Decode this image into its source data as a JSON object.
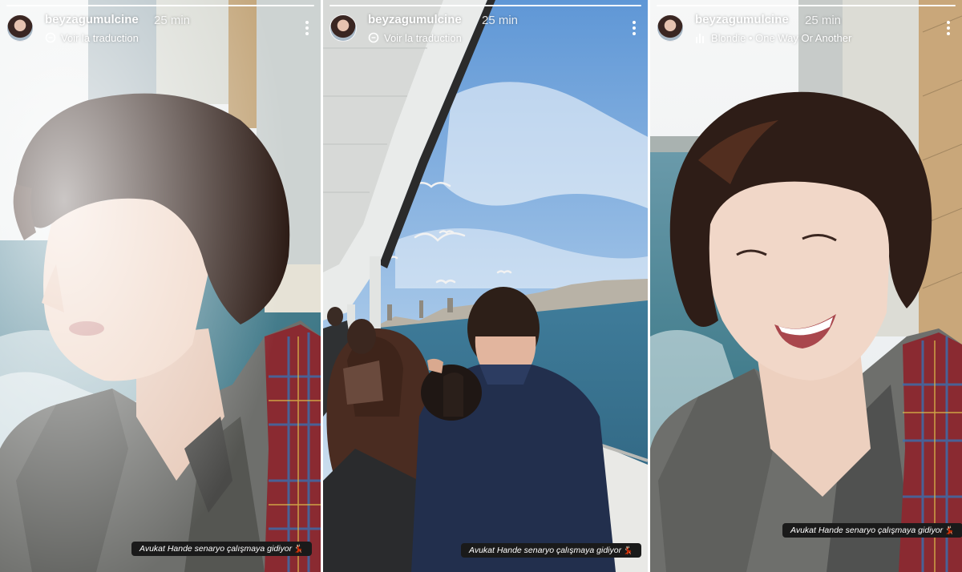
{
  "stories": [
    {
      "username": "beyzagumulcine",
      "time": "25 min",
      "subtitle": "Voir la traduction",
      "subtitle_icon": "translate-icon",
      "caption": "Avukat Hande senaryo çalışmaya gidiyor",
      "caption_emoji": "💃🏻"
    },
    {
      "username": "beyzagumulcine",
      "time": "25 min",
      "subtitle": "Voir la traduction",
      "subtitle_icon": "translate-icon",
      "caption": "Avukat Hande senaryo çalışmaya gidiyor",
      "caption_emoji": "💃🏻"
    },
    {
      "username": "beyzagumulcine",
      "time": "25 min",
      "subtitle": "Blondie • One Way Or Another",
      "subtitle_icon": "music-bars-icon",
      "caption": "Avukat Hande senaryo çalışmaya gidiyor",
      "caption_emoji": "💃🏻"
    }
  ],
  "colors": {
    "sea": "#4f8fa8",
    "sky": "#8fc0e6",
    "coat": "#6e6f6c",
    "scarf_red": "#b0303a",
    "hair": "#2e1d17"
  }
}
